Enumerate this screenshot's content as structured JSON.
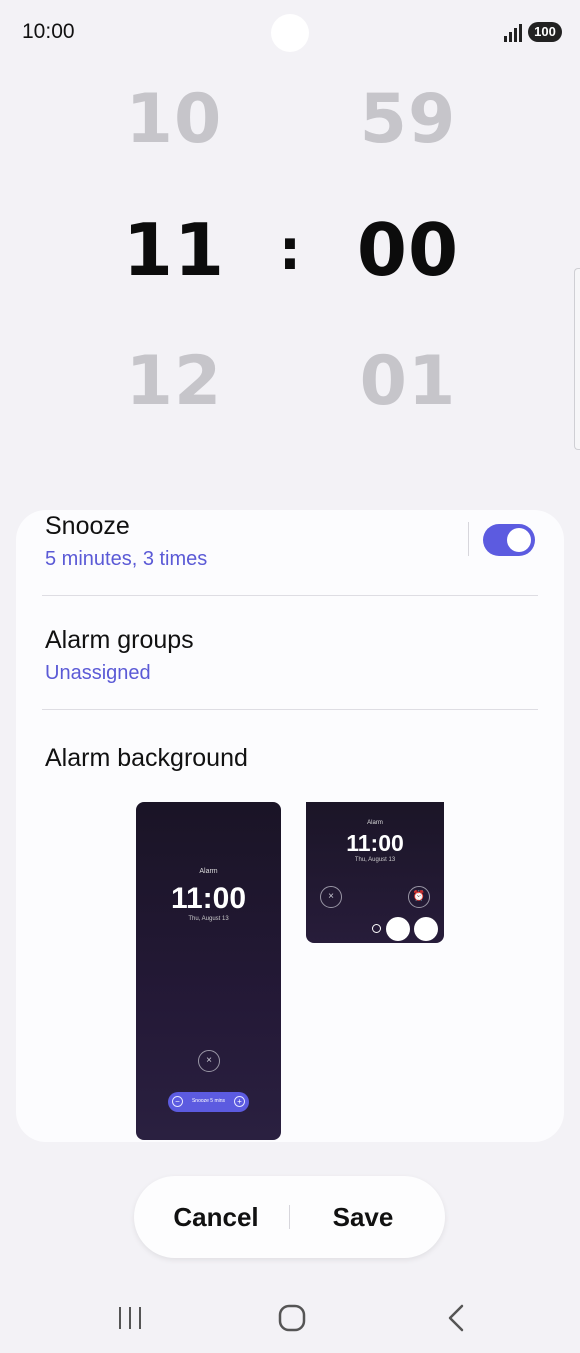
{
  "status_bar": {
    "time": "10:00",
    "battery": "100",
    "signal_icon": "signal-bars-icon"
  },
  "picker": {
    "hour_prev": "10",
    "hour": "11",
    "hour_next": "12",
    "minute_prev": "59",
    "minute": "00",
    "minute_next": "01",
    "separator": ":"
  },
  "settings": {
    "snooze": {
      "title": "Snooze",
      "subtitle": "5 minutes, 3 times",
      "enabled": true
    },
    "alarm_groups": {
      "title": "Alarm groups",
      "subtitle": "Unassigned"
    },
    "alarm_background": {
      "title": "Alarm background"
    }
  },
  "preview_tall": {
    "label": "Alarm",
    "time": "11:00",
    "date": "Thu, August 13",
    "snooze": "Snooze 5 mins",
    "minus": "−",
    "plus": "+",
    "close": "×"
  },
  "preview_small": {
    "label": "Alarm",
    "time": "11:00",
    "date": "Thu, August 13",
    "close": "×",
    "clock": "⏰"
  },
  "actions": {
    "cancel": "Cancel",
    "save": "Save"
  },
  "navigation": {
    "recents_icon": "recents-icon",
    "home_icon": "home-icon",
    "back_icon": "back-icon"
  },
  "colors": {
    "accent": "#5c5be0",
    "background": "#f3f2f6",
    "card": "#fcfcfe"
  }
}
